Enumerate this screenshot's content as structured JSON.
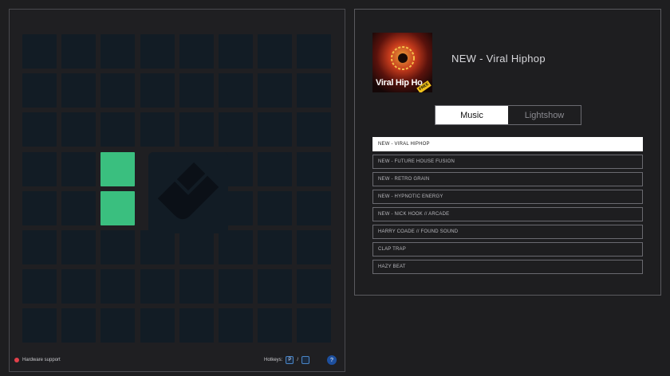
{
  "launchpad": {
    "rows": 8,
    "cols": 8,
    "active_pads": [
      [
        3,
        2
      ],
      [
        4,
        2
      ]
    ],
    "active_color": "#3abf7f",
    "pad_color": "#121c25"
  },
  "status": {
    "hardware_label": "Hardware support",
    "hotkeys_label": "Hotkeys:",
    "hotkey_1": "P",
    "hotkey_sep": "/",
    "hotkey_2": "",
    "help": "?"
  },
  "player": {
    "cover_text": "Viral Hip Ho",
    "cover_badge": "FREE",
    "title": "NEW - Viral Hiphop"
  },
  "tabs": [
    {
      "label": "Music",
      "active": true
    },
    {
      "label": "Lightshow",
      "active": false
    }
  ],
  "tracks": [
    {
      "label": "NEW - VIRAL HIPHOP",
      "selected": true
    },
    {
      "label": "NEW - FUTURE HOUSE FUSION",
      "selected": false
    },
    {
      "label": "NEW - RETRO GRAIN",
      "selected": false
    },
    {
      "label": "NEW - HYPNOTIC ENERGY",
      "selected": false
    },
    {
      "label": "NEW - NICK HOOK // ARCADE",
      "selected": false
    },
    {
      "label": "HARRY COADE // FOUND SOUND",
      "selected": false
    },
    {
      "label": "CLAP TRAP",
      "selected": false
    },
    {
      "label": "HAZY BEAT",
      "selected": false
    }
  ]
}
